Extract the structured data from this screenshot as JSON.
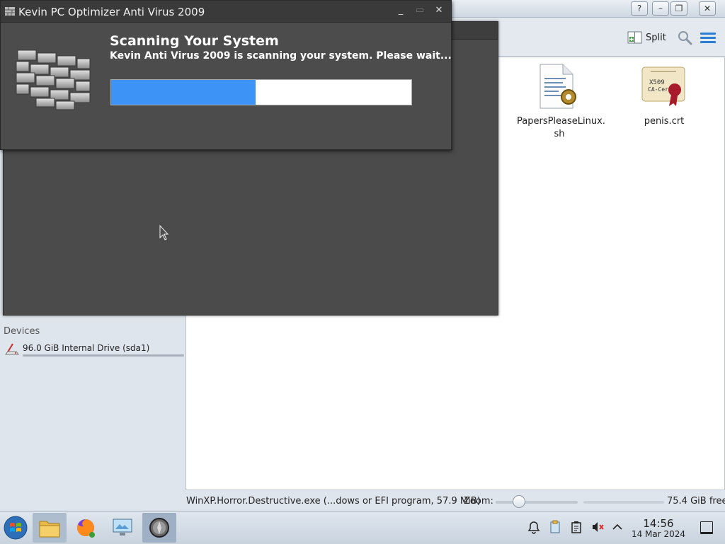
{
  "file_manager": {
    "toolbar": {
      "split_label": "Split"
    },
    "titlebar_buttons": {
      "help": "?",
      "minimize": "–",
      "maximize": "❐",
      "close": "✕"
    },
    "sidebar": {
      "devices_label": "Devices",
      "drive_label": "96.0 GiB Internal Drive (sda1)"
    },
    "files": [
      {
        "name": "PapersPleaseLinux.\nsh",
        "icon": "script-file-icon"
      },
      {
        "name": "penis.crt",
        "icon": "certificate-icon"
      }
    ],
    "status": {
      "selection_text": "WinXP.Horror.Destructive.exe (...dows or EFI program, 57.9 MiB)",
      "zoom_label": "Zoom:",
      "free_space": "75.4 GiB free"
    }
  },
  "antivirus_dialog": {
    "title": "Kevin PC Optimizer Anti Virus 2009",
    "heading": "Scanning Your System",
    "subtext": "Kevin Anti Virus 2009 is scanning your system. Please wait...",
    "progress": 0.48,
    "progress_color": "#3d94f6",
    "controls": {
      "minimize": "_",
      "maximize": "▭",
      "close": "✕"
    }
  },
  "taskbar": {
    "clock_time": "14:56",
    "clock_date": "14 Mar 2024"
  }
}
